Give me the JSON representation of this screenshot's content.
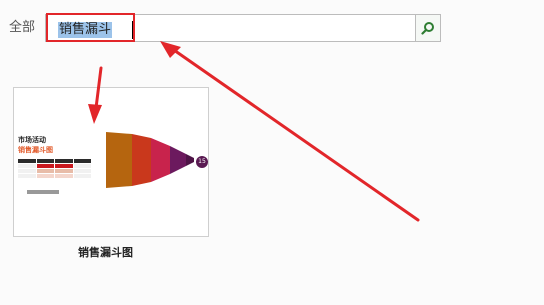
{
  "search": {
    "scope_label": "全部",
    "value": "销售漏斗",
    "button_icon": "search-icon"
  },
  "results": [
    {
      "title": "销售漏斗图",
      "thumbnail": {
        "heading_line1": "市场活动",
        "heading_line2": "销售漏斗图",
        "badge_value": "15"
      }
    }
  ],
  "annotation": {
    "highlight_color": "#e2262a",
    "arrow_color": "#e2262a"
  }
}
